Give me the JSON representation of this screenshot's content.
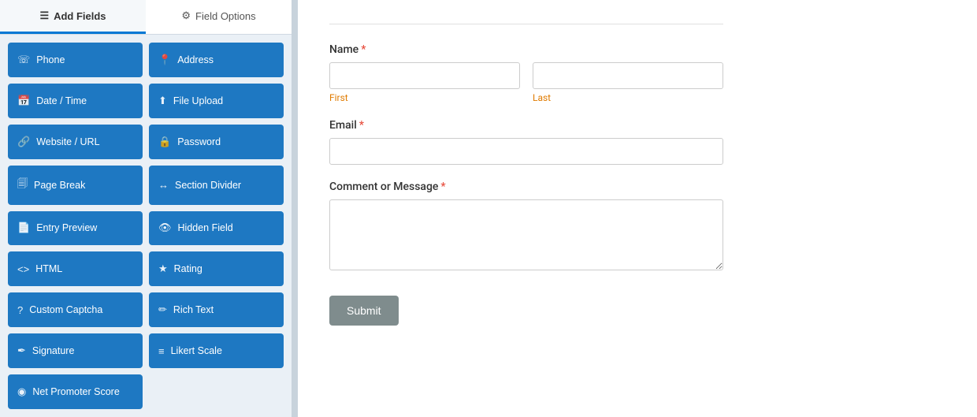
{
  "tabs": {
    "add_fields": {
      "label": "Add Fields",
      "icon": "☰",
      "active": true
    },
    "field_options": {
      "label": "Field Options",
      "icon": "⚙"
    }
  },
  "fields": [
    {
      "id": "phone",
      "label": "Phone",
      "icon": "☏"
    },
    {
      "id": "address",
      "label": "Address",
      "icon": "📍"
    },
    {
      "id": "datetime",
      "label": "Date / Time",
      "icon": "📅"
    },
    {
      "id": "file-upload",
      "label": "File Upload",
      "icon": "⬆"
    },
    {
      "id": "website",
      "label": "Website / URL",
      "icon": "🔗"
    },
    {
      "id": "password",
      "label": "Password",
      "icon": "🔒"
    },
    {
      "id": "page-break",
      "label": "Page Break",
      "icon": "🗐"
    },
    {
      "id": "section-divider",
      "label": "Section Divider",
      "icon": "↔"
    },
    {
      "id": "entry-preview",
      "label": "Entry Preview",
      "icon": "📄"
    },
    {
      "id": "hidden-field",
      "label": "Hidden Field",
      "icon": "👁"
    },
    {
      "id": "html",
      "label": "HTML",
      "icon": "<>"
    },
    {
      "id": "rating",
      "label": "Rating",
      "icon": "★"
    },
    {
      "id": "custom-captcha",
      "label": "Custom Captcha",
      "icon": "?"
    },
    {
      "id": "rich-text",
      "label": "Rich Text",
      "icon": "✏"
    },
    {
      "id": "signature",
      "label": "Signature",
      "icon": "✒"
    },
    {
      "id": "likert-scale",
      "label": "Likert Scale",
      "icon": "≡"
    },
    {
      "id": "net-promoter",
      "label": "Net Promoter Score",
      "icon": "◉"
    }
  ],
  "form": {
    "name_label": "Name",
    "name_required": "*",
    "first_placeholder": "",
    "first_sublabel": "First",
    "last_placeholder": "",
    "last_sublabel": "Last",
    "email_label": "Email",
    "email_required": "*",
    "email_placeholder": "",
    "message_label": "Comment or Message",
    "message_required": "*",
    "message_placeholder": "",
    "submit_label": "Submit"
  }
}
